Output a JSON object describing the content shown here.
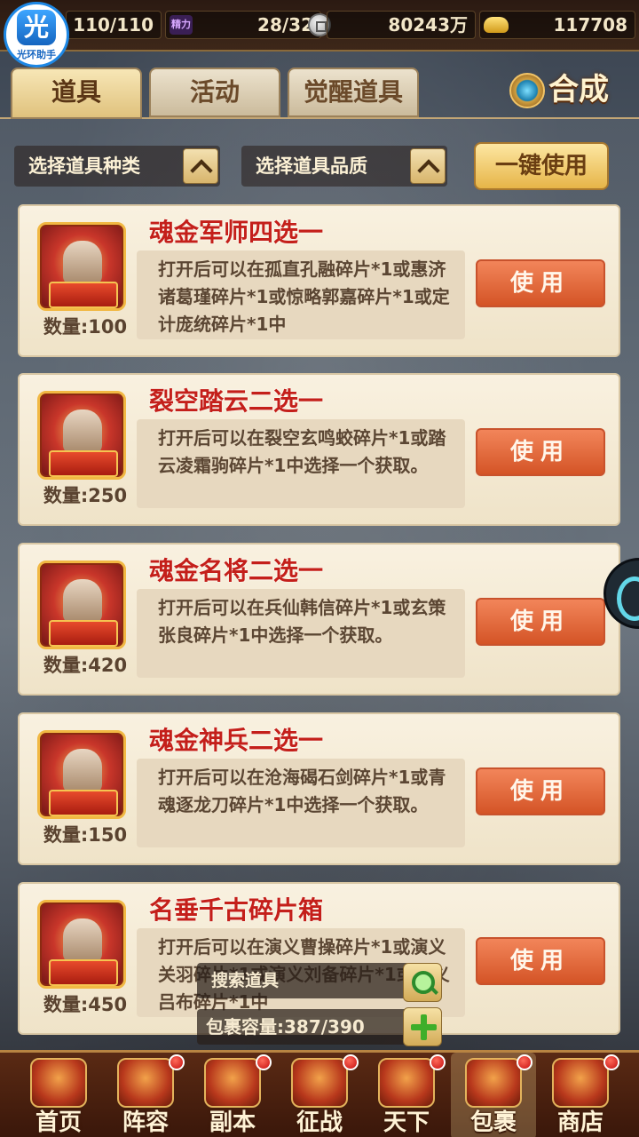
{
  "logo": {
    "char": "光",
    "text": "光环助手"
  },
  "resources": {
    "stamina": "110/110",
    "energy_tag": "精力",
    "energy": "28/32",
    "coins": "80243万",
    "ingots": "117708"
  },
  "tabs": [
    {
      "label": "道具",
      "active": true
    },
    {
      "label": "活动",
      "active": false
    },
    {
      "label": "觉醒道具",
      "active": false
    }
  ],
  "compose_label": "合成",
  "filters": {
    "type_label": "选择道具种类",
    "quality_label": "选择道具品质",
    "use_all_label": "一键使用"
  },
  "items": [
    {
      "title": "魂金军师四选一",
      "quantity": "数量:100",
      "description": "打开后可以在孤直孔融碎片*1或惠济诸葛瑾碎片*1或惊略郭嘉碎片*1或定计庞统碎片*1中",
      "use_label": "使用"
    },
    {
      "title": "裂空踏云二选一",
      "quantity": "数量:250",
      "description": "打开后可以在裂空玄鸣蛟碎片*1或踏云凌霜驹碎片*1中选择一个获取。",
      "use_label": "使用"
    },
    {
      "title": "魂金名将二选一",
      "quantity": "数量:420",
      "description": "打开后可以在兵仙韩信碎片*1或玄策张良碎片*1中选择一个获取。",
      "use_label": "使用"
    },
    {
      "title": "魂金神兵二选一",
      "quantity": "数量:150",
      "description": "打开后可以在沧海碣石剑碎片*1或青魂逐龙刀碎片*1中选择一个获取。",
      "use_label": "使用"
    },
    {
      "title": "名垂千古碎片箱",
      "quantity": "数量:450",
      "description": "打开后可以在演义曹操碎片*1或演义关羽碎片*1或演义刘备碎片*1或演义吕布碎片*1中",
      "use_label": "使用"
    }
  ],
  "search_label": "搜索道具",
  "capacity_label": "包裹容量:387/390",
  "bottom_nav": [
    {
      "label": "首页",
      "badge": false,
      "active": false
    },
    {
      "label": "阵容",
      "badge": true,
      "active": false
    },
    {
      "label": "副本",
      "badge": true,
      "active": false
    },
    {
      "label": "征战",
      "badge": true,
      "active": false
    },
    {
      "label": "天下",
      "badge": true,
      "active": false
    },
    {
      "label": "包裹",
      "badge": true,
      "active": true
    },
    {
      "label": "商店",
      "badge": true,
      "active": false
    }
  ]
}
